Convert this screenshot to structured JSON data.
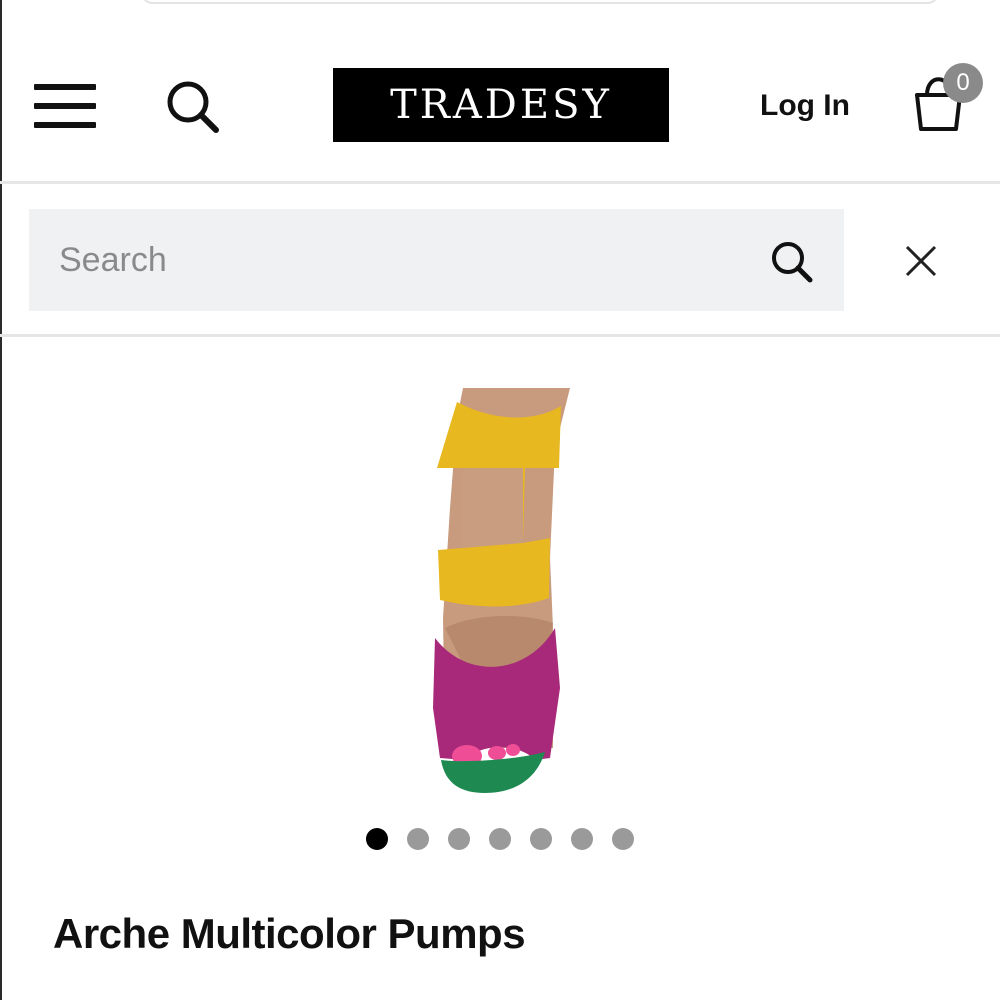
{
  "header": {
    "logo_text": "TRADESY",
    "login_label": "Log In",
    "cart_count": "0",
    "icons": [
      "hamburger-menu-icon",
      "search-icon",
      "shopping-bag-icon"
    ]
  },
  "search": {
    "placeholder": "Search",
    "value": "",
    "icons": [
      "search-icon",
      "close-icon"
    ]
  },
  "product": {
    "title": "Arche Multicolor Pumps",
    "image_colors": [
      "#e8b820",
      "#a8287a",
      "#1e8a52"
    ]
  },
  "carousel": {
    "total_images": 7,
    "active_index": 0
  }
}
